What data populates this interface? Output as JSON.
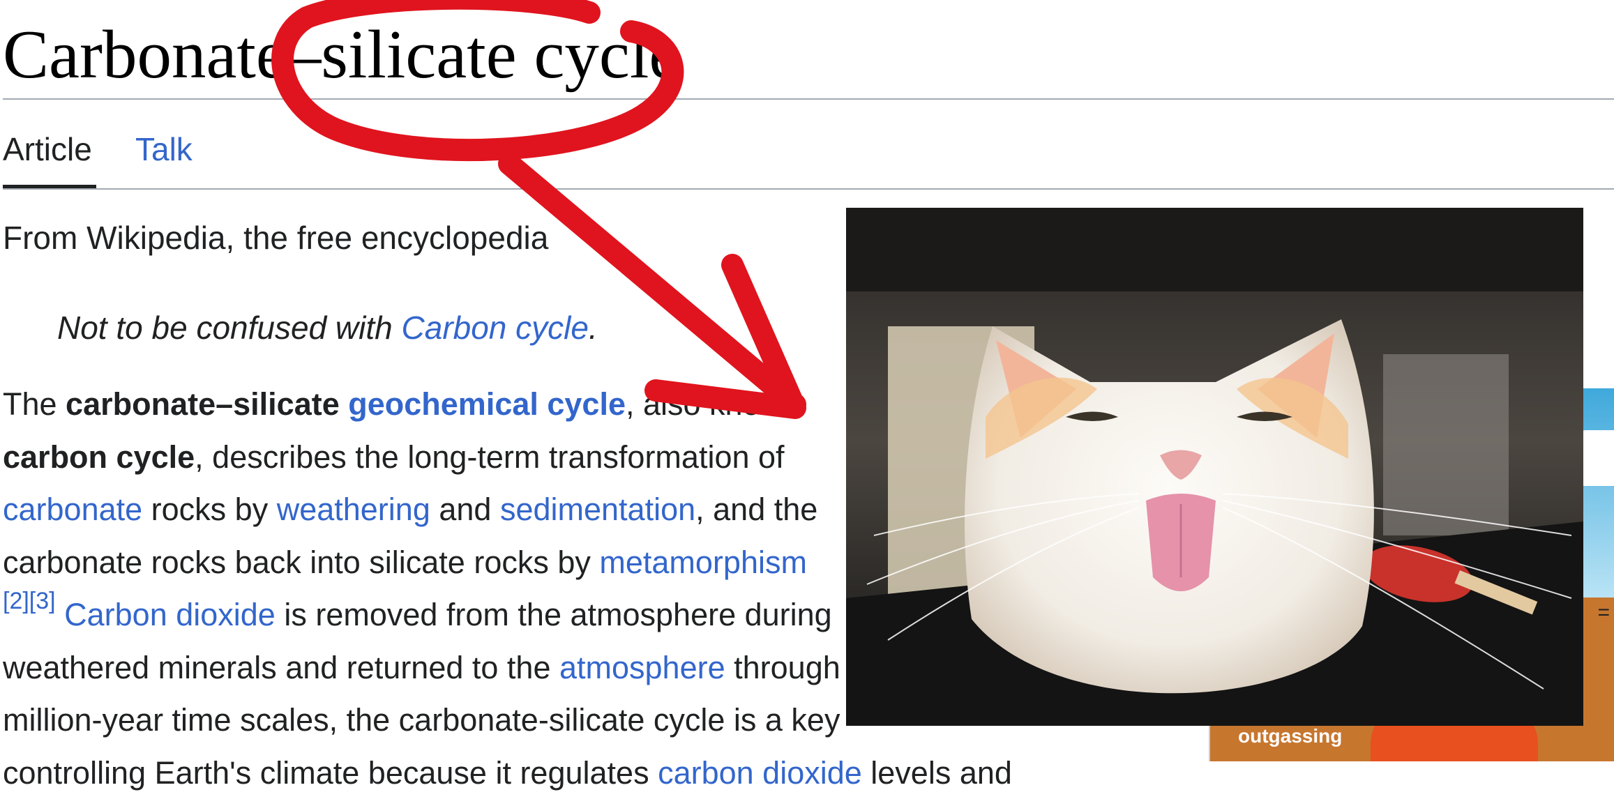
{
  "page": {
    "title": "Carbonate–silicate cycle",
    "tabs": [
      {
        "label": "Article",
        "selected": true
      },
      {
        "label": "Talk",
        "selected": false
      }
    ],
    "tagline": "From Wikipedia, the free encyclopedia",
    "hatnote": {
      "prefix": "Not to be confused with ",
      "link": "Carbon cycle",
      "suffix": "."
    }
  },
  "paragraph": {
    "l1_a": "The ",
    "l1_b": "carbonate–silicate",
    "l1_c": " ",
    "l1_link": "geochemical cycle",
    "l1_d": ", also known",
    "l2_b": "carbon cycle",
    "l2_a": ", describes the long-term transformation of",
    "l3_link1": "carbonate",
    "l3_a": " rocks by ",
    "l3_link2": "weathering",
    "l3_b": " and ",
    "l3_link3": "sedimentation",
    "l3_c": ", and the",
    "l4_a": "carbonate rocks back into silicate rocks by ",
    "l4_link": "metamorphism",
    "l5_sup": "[2][3]",
    "l5_link": "Carbon dioxide",
    "l5_a": " is removed from the atmosphere during",
    "l6_a": "weathered minerals and returned to the ",
    "l6_link": "atmosphere",
    "l6_b": " through",
    "l7_a": "million-year time scales, the carbonate-silicate cycle is a key",
    "l8_a": "controlling Earth's climate because it regulates ",
    "l8_link": "carbon dioxide",
    "l8_b": " levels and"
  },
  "figure": {
    "label": "outgassing",
    "eq_symbol": "="
  },
  "colors": {
    "link": "#3366cc",
    "text": "#202122",
    "annotation": "#e0141e"
  }
}
